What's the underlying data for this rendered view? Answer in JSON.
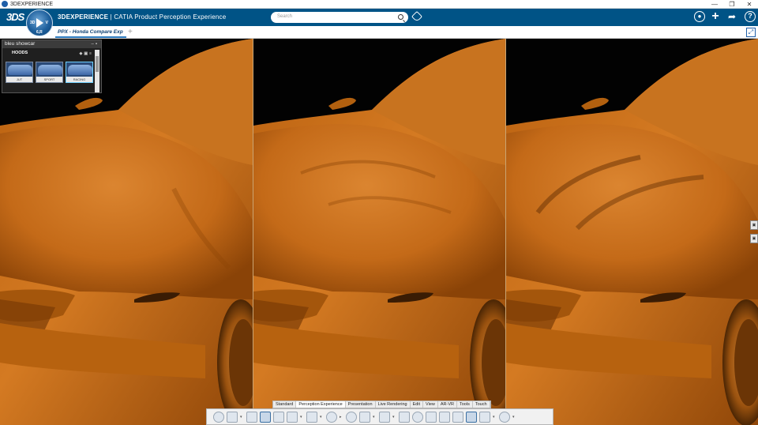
{
  "os_window": {
    "title": "3DEXPERIENCE",
    "controls": [
      "—",
      "❐",
      "✕"
    ]
  },
  "header": {
    "brand_bold": "3DEXPERIENCE",
    "brand_rest": " | CATIA Product Perception Experience",
    "logo_text": "3DS",
    "compass_labels": {
      "left": "3D",
      "right": "V",
      "bottom": "6,R"
    },
    "search_placeholder": "Search"
  },
  "tabs": {
    "active_tab": "PPX - Honda Compare Exp",
    "add_symbol": "+"
  },
  "showcar_panel": {
    "title": "bleu showcar",
    "section": "HOODS",
    "thumbnails": [
      {
        "caption": "JUT",
        "selected": false
      },
      {
        "caption": "SPORT",
        "selected": false
      },
      {
        "caption": "RACING",
        "selected": true
      }
    ]
  },
  "viewports": [
    {
      "variant": "hood-smooth"
    },
    {
      "variant": "hood-creased"
    },
    {
      "variant": "hood-sharp"
    }
  ],
  "colors": {
    "accent": "#005386",
    "model": "#c46a18",
    "background": "#020202"
  },
  "action_bar": {
    "tabs": [
      "Standard",
      "Perception Experience",
      "Presentation",
      "Live Rendering",
      "Edit",
      "View",
      "AR-VR",
      "Tools",
      "Touch"
    ],
    "active_tab": "Perception Experience",
    "tools": [
      "zoom-icon",
      "render-list-icon",
      "view-frame-icon",
      "view-select-icon",
      "box-icon",
      "bulk-icon",
      "walk-icon",
      "compass-view-icon",
      "play-icon",
      "stop-icon",
      "draw-icon",
      "sketch-icon",
      "measure-icon",
      "magnify-icon",
      "zoom-area-icon",
      "group-icon",
      "navigator-icon",
      "camera-icon",
      "settings-icon"
    ]
  }
}
